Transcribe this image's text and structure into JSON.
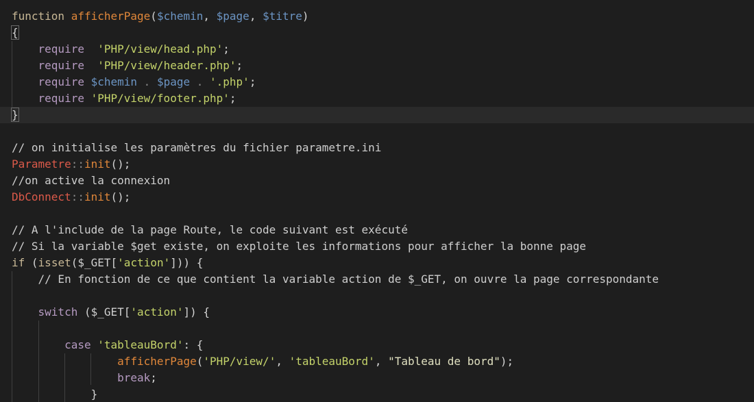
{
  "editor": {
    "lines": [
      {
        "tokens": [
          {
            "t": "function ",
            "c": "kw"
          },
          {
            "t": "afficherPage",
            "c": "fn"
          },
          {
            "t": "(",
            "c": "punc"
          },
          {
            "t": "$chemin",
            "c": "var"
          },
          {
            "t": ", ",
            "c": "punc"
          },
          {
            "t": "$page",
            "c": "var"
          },
          {
            "t": ", ",
            "c": "punc"
          },
          {
            "t": "$titre",
            "c": "var"
          },
          {
            "t": ")",
            "c": "punc"
          }
        ]
      },
      {
        "tokens": [
          {
            "t": "{",
            "c": "punc",
            "match": true
          }
        ]
      },
      {
        "tokens": [
          {
            "t": "    ",
            "c": "punc"
          },
          {
            "t": "require  ",
            "c": "req"
          },
          {
            "t": "'PHP/view/head.php'",
            "c": "str"
          },
          {
            "t": ";",
            "c": "punc"
          }
        ]
      },
      {
        "tokens": [
          {
            "t": "    ",
            "c": "punc"
          },
          {
            "t": "require  ",
            "c": "req"
          },
          {
            "t": "'PHP/view/header.php'",
            "c": "str"
          },
          {
            "t": ";",
            "c": "punc"
          }
        ]
      },
      {
        "tokens": [
          {
            "t": "    ",
            "c": "punc"
          },
          {
            "t": "require ",
            "c": "req"
          },
          {
            "t": "$chemin",
            "c": "var"
          },
          {
            "t": " . ",
            "c": "op"
          },
          {
            "t": "$page",
            "c": "var"
          },
          {
            "t": " . ",
            "c": "op"
          },
          {
            "t": "'.php'",
            "c": "str"
          },
          {
            "t": ";",
            "c": "punc"
          }
        ]
      },
      {
        "tokens": [
          {
            "t": "    ",
            "c": "punc"
          },
          {
            "t": "require ",
            "c": "req"
          },
          {
            "t": "'PHP/view/footer.php'",
            "c": "str"
          },
          {
            "t": ";",
            "c": "punc"
          }
        ]
      },
      {
        "current": true,
        "tokens": [
          {
            "t": "}",
            "c": "punc",
            "match": true
          }
        ]
      },
      {
        "tokens": []
      },
      {
        "tokens": [
          {
            "t": "// on initialise les paramètres du fichier parametre.ini",
            "c": "cmt"
          }
        ]
      },
      {
        "tokens": [
          {
            "t": "Parametre",
            "c": "cls"
          },
          {
            "t": "::",
            "c": "op"
          },
          {
            "t": "init",
            "c": "fn"
          },
          {
            "t": "();",
            "c": "punc"
          }
        ]
      },
      {
        "tokens": [
          {
            "t": "//on active la connexion",
            "c": "cmt"
          }
        ]
      },
      {
        "tokens": [
          {
            "t": "DbConnect",
            "c": "cls"
          },
          {
            "t": "::",
            "c": "op"
          },
          {
            "t": "init",
            "c": "fn"
          },
          {
            "t": "();",
            "c": "punc"
          }
        ]
      },
      {
        "tokens": []
      },
      {
        "tokens": [
          {
            "t": "// A l'include de la page Route, le code suivant est exécuté",
            "c": "cmt"
          }
        ]
      },
      {
        "tokens": [
          {
            "t": "// Si la variable $get existe, on exploite les informations pour afficher la bonne page",
            "c": "cmt"
          }
        ]
      },
      {
        "tokens": [
          {
            "t": "if ",
            "c": "kw"
          },
          {
            "t": "(",
            "c": "punc"
          },
          {
            "t": "isset",
            "c": "kw"
          },
          {
            "t": "(",
            "c": "punc"
          },
          {
            "t": "$_GET",
            "c": "cmt"
          },
          {
            "t": "[",
            "c": "punc"
          },
          {
            "t": "'action'",
            "c": "str"
          },
          {
            "t": "])) {",
            "c": "punc"
          }
        ]
      },
      {
        "tokens": [
          {
            "t": "    ",
            "c": "punc"
          },
          {
            "t": "// En fonction de ce que contient la variable action de $_GET, on ouvre la page correspondante",
            "c": "cmt"
          }
        ]
      },
      {
        "tokens": []
      },
      {
        "tokens": [
          {
            "t": "    ",
            "c": "punc"
          },
          {
            "t": "switch ",
            "c": "req"
          },
          {
            "t": "(",
            "c": "punc"
          },
          {
            "t": "$_GET",
            "c": "cmt"
          },
          {
            "t": "[",
            "c": "punc"
          },
          {
            "t": "'action'",
            "c": "str"
          },
          {
            "t": "]) {",
            "c": "punc"
          }
        ]
      },
      {
        "tokens": []
      },
      {
        "tokens": [
          {
            "t": "        ",
            "c": "punc"
          },
          {
            "t": "case ",
            "c": "req"
          },
          {
            "t": "'tableauBord'",
            "c": "str"
          },
          {
            "t": ": {",
            "c": "punc"
          }
        ]
      },
      {
        "tokens": [
          {
            "t": "                ",
            "c": "punc"
          },
          {
            "t": "afficherPage",
            "c": "fn"
          },
          {
            "t": "(",
            "c": "punc"
          },
          {
            "t": "'PHP/view/'",
            "c": "str"
          },
          {
            "t": ", ",
            "c": "punc"
          },
          {
            "t": "'tableauBord'",
            "c": "str"
          },
          {
            "t": ", ",
            "c": "punc"
          },
          {
            "t": "\"Tableau de bord\"",
            "c": "dq"
          },
          {
            "t": ");",
            "c": "punc"
          }
        ]
      },
      {
        "tokens": [
          {
            "t": "                ",
            "c": "punc"
          },
          {
            "t": "break",
            "c": "req"
          },
          {
            "t": ";",
            "c": "punc"
          }
        ]
      },
      {
        "tokens": [
          {
            "t": "            ",
            "c": "punc"
          },
          {
            "t": "}",
            "c": "punc"
          }
        ]
      }
    ]
  }
}
